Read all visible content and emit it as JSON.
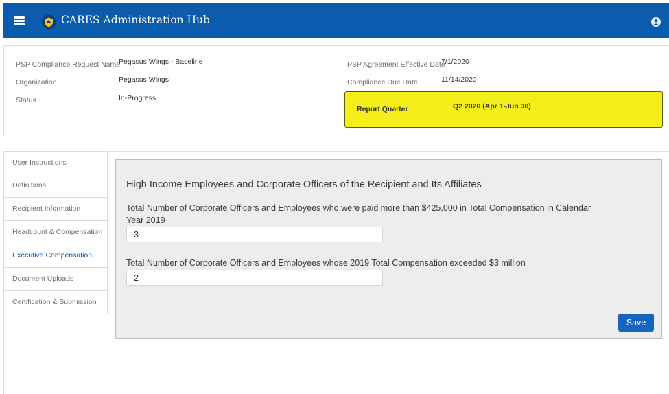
{
  "header": {
    "title": "CARES Administration Hub",
    "menu_icon": "hamburger-icon",
    "logo_icon": "shield-logo-icon",
    "user_icon": "user-avatar-icon",
    "bar_color": "#0b5cad"
  },
  "info": {
    "request_name_label": "PSP Compliance Request Name",
    "request_name_value": "Pegasus Wings - Baseline",
    "organization_label": "Organization",
    "organization_value": "Pegasus Wings",
    "status_label": "Status",
    "status_value": "In-Progress",
    "effective_date_label": "PSP Agreement Effective Date",
    "effective_date_value": "7/1/2020",
    "due_date_label": "Compliance Due Date",
    "due_date_value": "11/14/2020",
    "report_quarter_label": "Report Quarter",
    "report_quarter_value": "Q2 2020 (Apr 1-Jun 30)",
    "highlight_color": "#f6ee1a"
  },
  "sidebar": {
    "items": [
      {
        "label": "User Instructions"
      },
      {
        "label": "Definitions"
      },
      {
        "label": "Recipient Information"
      },
      {
        "label": "Headcount & Compensation"
      },
      {
        "label": "Executive Compensation"
      },
      {
        "label": "Document Uploads"
      },
      {
        "label": "Certification & Submission"
      }
    ],
    "active_index": 4
  },
  "form": {
    "title": "High Income Employees and Corporate Officers of the Recipient and Its Affiliates",
    "q1_label": "Total Number of Corporate Officers and Employees who were paid more than $425,000 in Total Compensation in Calendar Year 2019",
    "q1_value": "3",
    "q2_label": "Total Number of Corporate Officers and Employees whose 2019 Total Compensation exceeded $3 million",
    "q2_value": "2",
    "save_label": "Save"
  }
}
